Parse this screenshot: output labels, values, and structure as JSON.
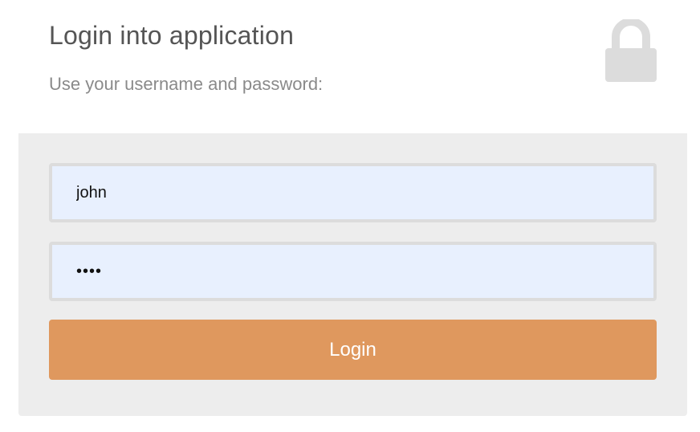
{
  "header": {
    "title": "Login into application",
    "subtitle": "Use your username and password:",
    "icon": "lock-icon"
  },
  "form": {
    "username": {
      "value": "john",
      "type": "text"
    },
    "password": {
      "value": "••••",
      "type": "password"
    },
    "login_label": "Login"
  },
  "colors": {
    "panel_background": "#ededed",
    "input_background": "#e8f0fe",
    "input_border": "#dcdcdc",
    "button": "#df985e",
    "button_text": "#ffffff",
    "icon": "#dcdcdc",
    "title_text": "#555555",
    "subtitle_text": "#8a8a8a"
  }
}
